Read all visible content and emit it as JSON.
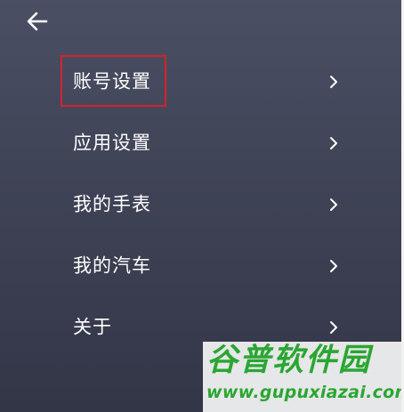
{
  "header": {
    "back_icon": "arrow-left-icon"
  },
  "menu": {
    "items": [
      {
        "label": "账号设置",
        "icon": "chevron-right-icon",
        "highlighted": true
      },
      {
        "label": "应用设置",
        "icon": "chevron-right-icon"
      },
      {
        "label": "我的手表",
        "icon": "chevron-right-icon"
      },
      {
        "label": "我的汽车",
        "icon": "chevron-right-icon"
      },
      {
        "label": "关于",
        "icon": "chevron-right-icon"
      }
    ]
  },
  "highlight": {
    "color": "#d8212b"
  },
  "watermark": {
    "title": "谷普软件园",
    "url": "www.gupuxiazai.com",
    "color": "#2aa632"
  },
  "colors": {
    "background": "#3f4356",
    "text": "#ffffff"
  }
}
